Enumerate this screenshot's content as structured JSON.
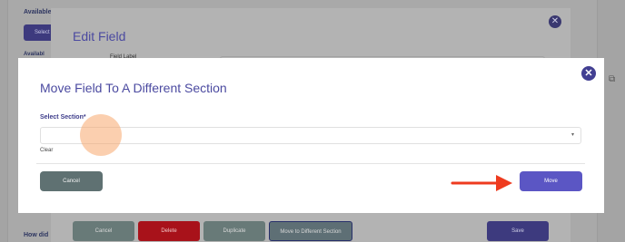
{
  "background": {
    "available_label": "Available",
    "select_button_label": "Select",
    "available_secondary_label": "Availabl",
    "how_did_label": "How did"
  },
  "edit_field_modal": {
    "title": "Edit Field",
    "field_label": "Field Label",
    "footer": {
      "cancel_label": "Cancel",
      "delete_label": "Delete",
      "duplicate_label": "Duplicate",
      "move_label": "Move to Different Section",
      "save_label": "Save"
    }
  },
  "move_field_modal": {
    "title": "Move Field To A Different Section",
    "select_label": "Select Section*",
    "select_value": "",
    "clear_label": "Clear",
    "cancel_label": "Cancel",
    "move_label": "Move",
    "close_glyph": "✕"
  },
  "icons": {
    "close_icon": "✕",
    "chevron_down_icon": "▾",
    "copy_icon": "⧉"
  },
  "colors": {
    "accent": "#5b56c4",
    "title_color": "#4b4aa0",
    "danger": "#a8121a",
    "secondary": "#5f7172",
    "highlight": "#f7a86e",
    "annotation_arrow": "#ee3b1f"
  }
}
